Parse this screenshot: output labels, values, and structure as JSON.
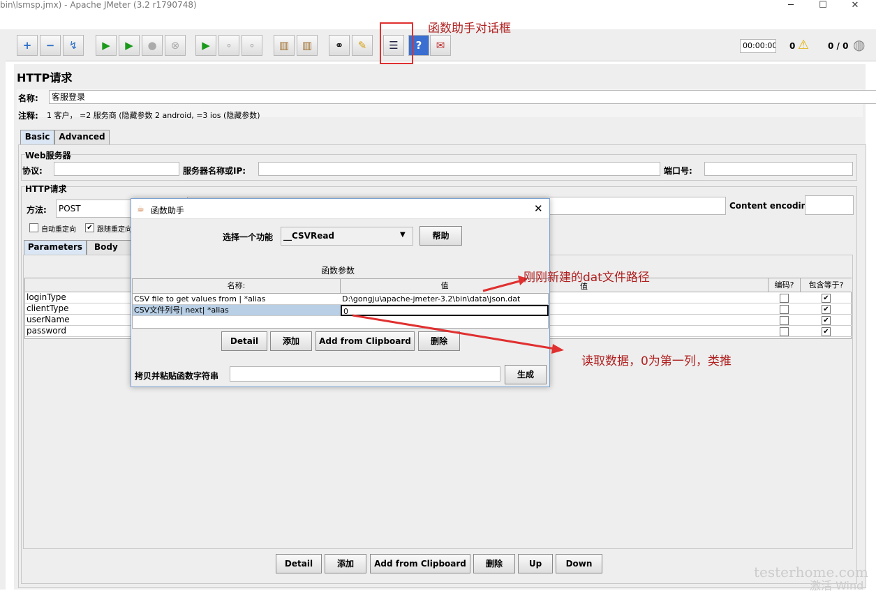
{
  "window": {
    "title": "bin\\lsmsp.jmx) - Apache JMeter (3.2 r1790748)"
  },
  "toolbar": {
    "timer": "00:00:00",
    "warn_count": "0",
    "threads": "0 / 0"
  },
  "sampler": {
    "title": "HTTP请求",
    "name_label": "名称:",
    "name_value": "客服登录",
    "comment_label": "注释:",
    "comment_value": "1 客户， =2 服务商 (隐藏参数 2 android, =3 ios (隐藏参数)"
  },
  "tabs": {
    "basic": "Basic",
    "advanced": "Advanced"
  },
  "web_server": {
    "legend": "Web服务器",
    "protocol_label": "协议:",
    "server_label": "服务器名称或IP:",
    "port_label": "端口号:"
  },
  "http_request": {
    "legend": "HTTP请求",
    "method_label": "方法:",
    "method_value": "POST",
    "encoding_label": "Content encoding:",
    "redirect_auto": "自动重定向",
    "redirect_follow": "跟随重定向"
  },
  "subtabs": {
    "parameters": "Parameters",
    "body": "Body Data"
  },
  "params": {
    "value_header": "值",
    "encode_header": "编码?",
    "include_header": "包含等于?",
    "rows": [
      {
        "name": "loginType",
        "encode": false,
        "include": true
      },
      {
        "name": "clientType",
        "encode": false,
        "include": true
      },
      {
        "name": "userName",
        "encode": false,
        "include": true
      },
      {
        "name": "password",
        "encode": false,
        "include": true
      }
    ]
  },
  "bottom_buttons": [
    "Detail",
    "添加",
    "Add from Clipboard",
    "删除",
    "Up",
    "Down"
  ],
  "dialog": {
    "title": "函数助手",
    "select_label": "选择一个功能",
    "select_value": "__CSVRead",
    "help": "帮助",
    "params_title": "函数参数",
    "col_name": "名称:",
    "col_value": "值",
    "rows": [
      {
        "name": "CSV file to get values from | *alias",
        "value": "D:\\gongju\\apache-jmeter-3.2\\bin\\data\\json.dat"
      },
      {
        "name": "CSV文件列号| next| *alias",
        "value": "0"
      }
    ],
    "buttons": [
      "Detail",
      "添加",
      "Add from Clipboard",
      "删除"
    ],
    "copy_label": "拷贝并粘贴函数字符串",
    "generate": "生成"
  },
  "annotations": {
    "top": "函数助手对话框",
    "path": "刚刚新建的dat文件路径",
    "read": "读取数据，0为第一列，类推"
  },
  "watermark": {
    "site": "testerhome.com",
    "activate": "激活 Wind"
  }
}
